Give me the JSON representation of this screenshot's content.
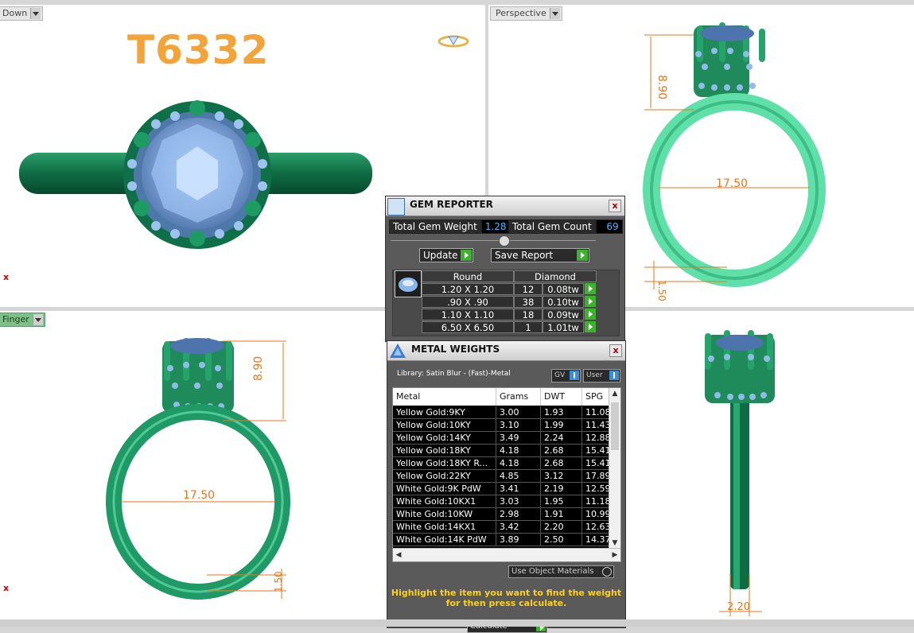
{
  "viewports": {
    "top": {
      "label": "Down"
    },
    "persp": {
      "label": "Perspective"
    },
    "finger": {
      "label": "Finger"
    }
  },
  "ref_code": "T6332",
  "axis_marker": "x",
  "dims": {
    "height": "8.90",
    "inner_diameter": "17.50",
    "shank_thickness": "1.50",
    "shank_width": "2.20"
  },
  "gem_reporter": {
    "title": "GEM REPORTER",
    "close": "x",
    "total_weight_label": "Total Gem Weight",
    "total_weight_value": "1.28",
    "total_count_label": "Total Gem Count",
    "total_count_value": "69",
    "update_label": "Update",
    "save_report_label": "Save Report",
    "table": {
      "shape": "Round",
      "material": "Diamond",
      "rows": [
        {
          "size": "1.20 X 1.20",
          "count": "12",
          "tw": "0.08tw"
        },
        {
          "size": ".90 X .90",
          "count": "38",
          "tw": "0.10tw"
        },
        {
          "size": "1.10 X 1.10",
          "count": "18",
          "tw": "0.09tw"
        },
        {
          "size": "6.50 X 6.50",
          "count": "1",
          "tw": "1.01tw"
        }
      ]
    }
  },
  "metal_weights": {
    "title": "METAL WEIGHTS",
    "close": "x",
    "library_label": "Library: Satin Blur - (Fast)-Metal",
    "gv_label": "GV",
    "user_label": "User",
    "columns": [
      "Metal",
      "Grams",
      "DWT",
      "SPG"
    ],
    "rows": [
      {
        "metal": "Yellow Gold:9KY",
        "grams": "3.00",
        "dwt": "1.93",
        "spg": "11.08"
      },
      {
        "metal": "Yellow Gold:10KY",
        "grams": "3.10",
        "dwt": "1.99",
        "spg": "11.43"
      },
      {
        "metal": "Yellow Gold:14KY",
        "grams": "3.49",
        "dwt": "2.24",
        "spg": "12.88"
      },
      {
        "metal": "Yellow Gold:18KY",
        "grams": "4.18",
        "dwt": "2.68",
        "spg": "15.41"
      },
      {
        "metal": "Yellow Gold:18KY R...",
        "grams": "4.18",
        "dwt": "2.68",
        "spg": "15.41"
      },
      {
        "metal": "Yellow Gold:22KY",
        "grams": "4.85",
        "dwt": "3.12",
        "spg": "17.89"
      },
      {
        "metal": "White Gold:9K PdW",
        "grams": "3.41",
        "dwt": "2.19",
        "spg": "12.59"
      },
      {
        "metal": "White Gold:10KX1",
        "grams": "3.03",
        "dwt": "1.95",
        "spg": "11.18"
      },
      {
        "metal": "White Gold:10KW",
        "grams": "2.98",
        "dwt": "1.91",
        "spg": "10.99"
      },
      {
        "metal": "White Gold:14KX1",
        "grams": "3.42",
        "dwt": "2.20",
        "spg": "12.63"
      },
      {
        "metal": "White Gold:14K PdW",
        "grams": "3.89",
        "dwt": "2.50",
        "spg": "14.37"
      }
    ],
    "use_object_materials": "Use Object Materials",
    "hint": "Highlight the item you want to find the weight for then press calculate.",
    "calculate_label": "Calculate"
  },
  "colors": {
    "ring_green": "#1f8a5a",
    "ring_light": "#6ee8b4",
    "gem_blue": "#8ab6ea",
    "dim_orange": "#e8761c",
    "ref_orange": "#f2a33a"
  }
}
